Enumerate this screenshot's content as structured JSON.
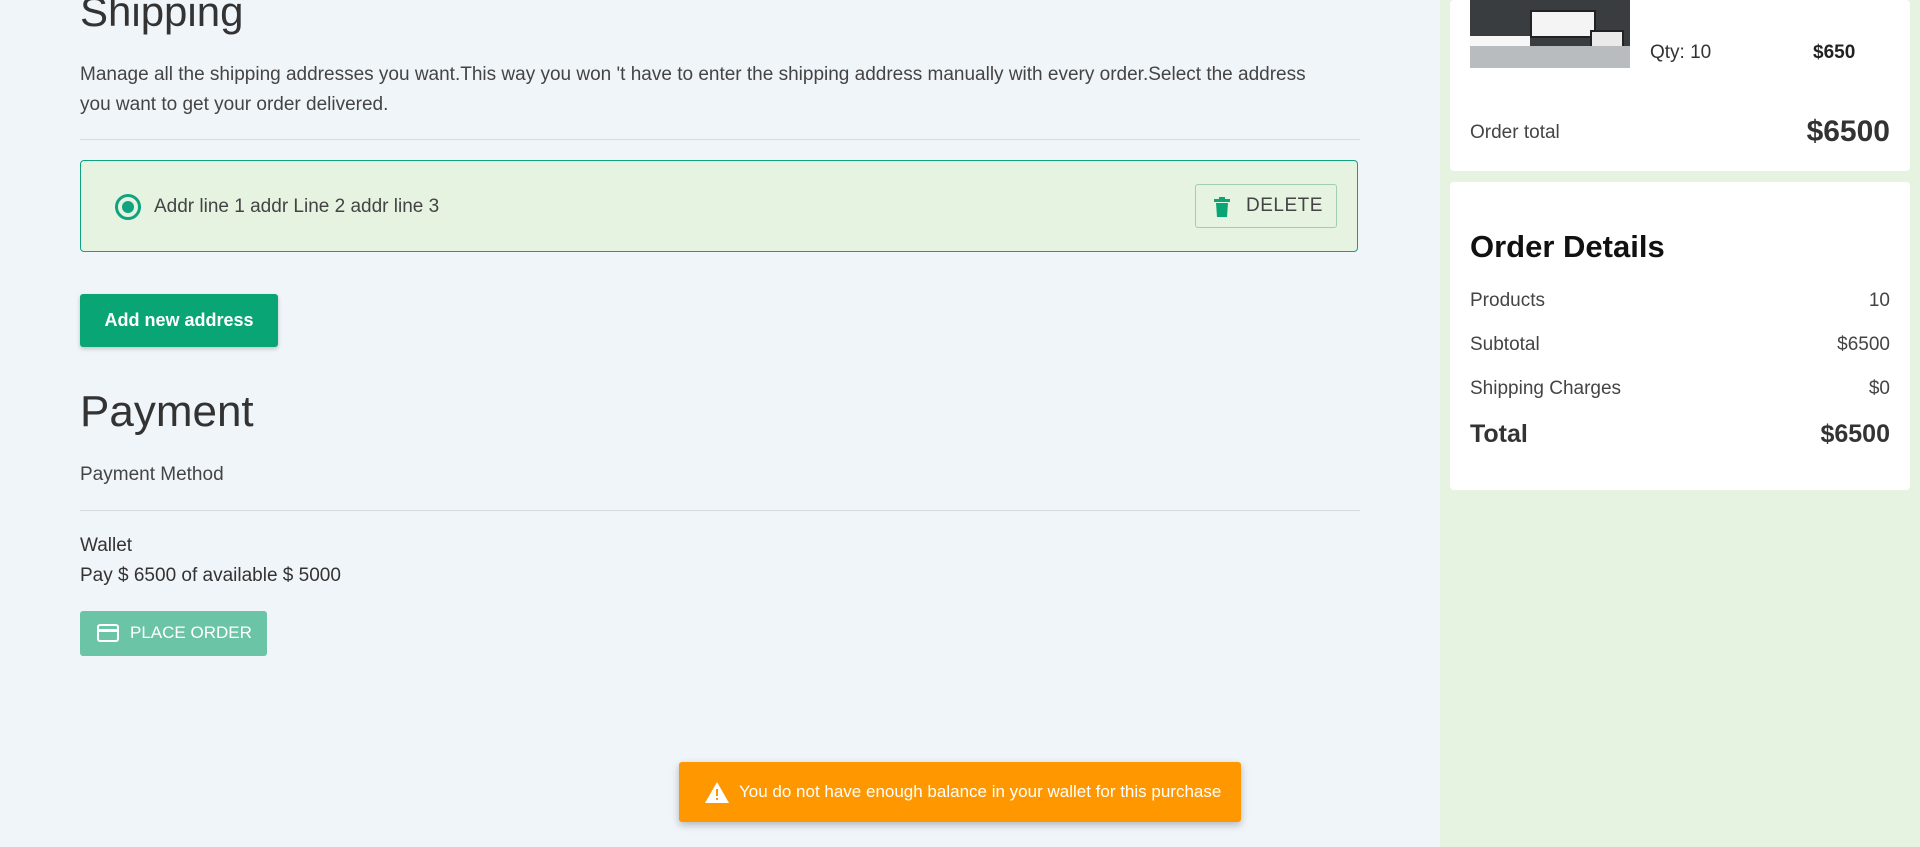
{
  "shipping": {
    "title": "Shipping",
    "description": "Manage all the shipping addresses you want.This way you won 't have to enter the shipping address manually with every order.Select the address you want to get your order delivered.",
    "address": "Addr line 1 addr Line 2 addr line 3",
    "delete_label": "DELETE",
    "add_label": "Add new address"
  },
  "payment": {
    "title": "Payment",
    "method_label": "Payment Method",
    "wallet": "Wallet",
    "pay_text": "Pay $ 6500 of available $ 5000",
    "place_order_label": "PLACE ORDER"
  },
  "toast": {
    "message": "You do not have enough balance in your wallet for this purchase"
  },
  "cart": {
    "qty": "Qty: 10",
    "price": "$650",
    "order_total_label": "Order total",
    "order_total_value": "$6500"
  },
  "order_details": {
    "title": "Order Details",
    "rows": [
      {
        "label": "Products",
        "value": "10"
      },
      {
        "label": "Subtotal",
        "value": "$6500"
      },
      {
        "label": "Shipping Charges",
        "value": "$0"
      }
    ],
    "total_label": "Total",
    "total_value": "$6500"
  },
  "colors": {
    "accent": "#0aa574",
    "warning": "#ff9800",
    "selected_bg": "#e6f3e0"
  }
}
